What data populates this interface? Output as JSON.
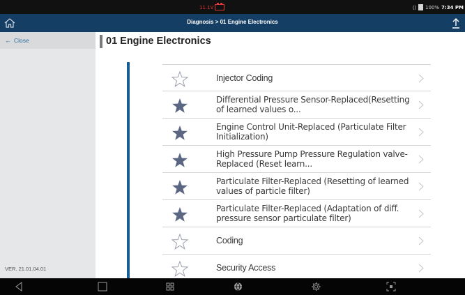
{
  "status_bar": {
    "voltage": "11.1V",
    "signal": "⟨⟩",
    "battery": "100%",
    "time": "7:34 PM"
  },
  "title_bar": {
    "title": "Diagnosis > 01 Engine Electronics"
  },
  "sidebar": {
    "close_label": "Close",
    "version": "VER. 21.01.04.01"
  },
  "main": {
    "page_title": "01 Engine Electronics",
    "items": [
      {
        "label": "Injector Coding",
        "favorite": false
      },
      {
        "label": "Differential Pressure Sensor-Replaced(Resetting of learned values o...",
        "favorite": true
      },
      {
        "label": "Engine Control Unit-Replaced (Particulate Filter Initialization)",
        "favorite": true
      },
      {
        "label": "High Pressure Pump Pressure Regulation valve-Replaced (Reset learn...",
        "favorite": true
      },
      {
        "label": "Particulate Filter-Replaced (Resetting of learned values of particle filter)",
        "favorite": true
      },
      {
        "label": "Particulate Filter-Replaced (Adaptation of diff. pressure sensor particulate filter)",
        "favorite": true
      },
      {
        "label": "Coding",
        "favorite": false
      },
      {
        "label": "Security Access",
        "favorite": false
      }
    ]
  },
  "colors": {
    "title_bar": "#143e63",
    "rail": "#1a5e93",
    "star_filled": "#5b6683",
    "sidebar": "#e6e7e9",
    "voltage": "#e53935"
  },
  "icons": {
    "home": "home-icon",
    "share": "share-icon",
    "back": "back-icon",
    "recents": "recents-icon",
    "apps": "apps-icon",
    "browser": "globe-icon",
    "settings": "gear-icon",
    "screenshot": "screenshot-icon"
  }
}
